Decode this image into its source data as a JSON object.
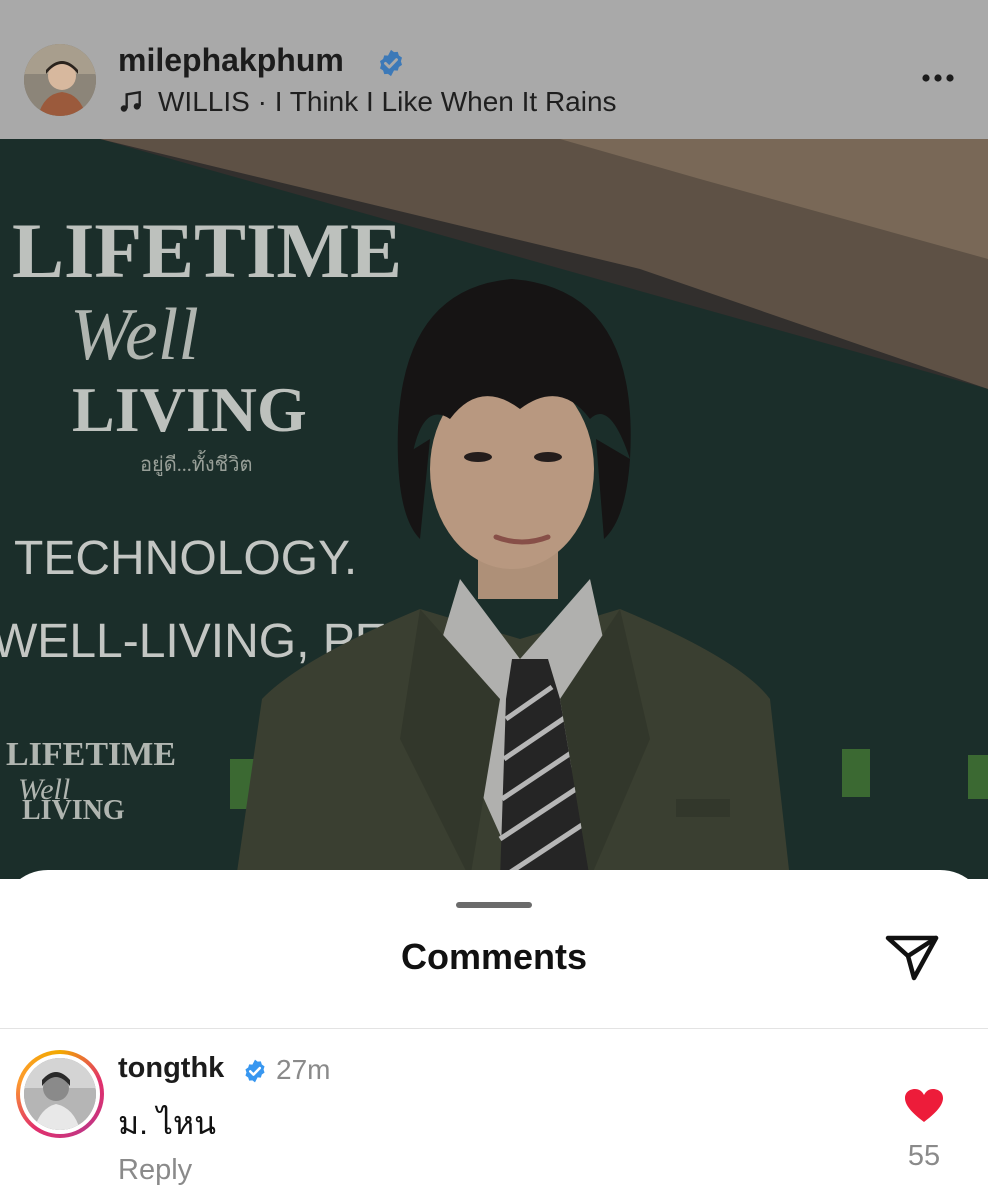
{
  "post_header": {
    "username": "milephakphum",
    "music_text": "WILLIS · I Think I Like When It Rains",
    "icons": [
      "avatar",
      "verified-badge-icon",
      "music-note-icon",
      "more-icon"
    ]
  },
  "photo": {
    "backdrop_text": [
      "LIFETIME",
      "Well",
      "LIVING",
      "อยู่ดี...ทั้งชีวิต",
      "TECHNOLOGY.",
      "WELL-LIVING, PE"
    ],
    "small_logo_text": [
      "LIFETIME",
      "Well",
      "LIVING"
    ]
  },
  "comments_sheet": {
    "title": "Comments",
    "comments": [
      {
        "username": "tongthk",
        "time": "27m",
        "text": "ม. ไหน",
        "reply_label": "Reply",
        "likes": "55"
      }
    ]
  },
  "colors": {
    "verified": "#3897f0",
    "heart": "#ed1c3a",
    "header_dim": "#a9a9a9",
    "backdrop": "#1f3530"
  }
}
